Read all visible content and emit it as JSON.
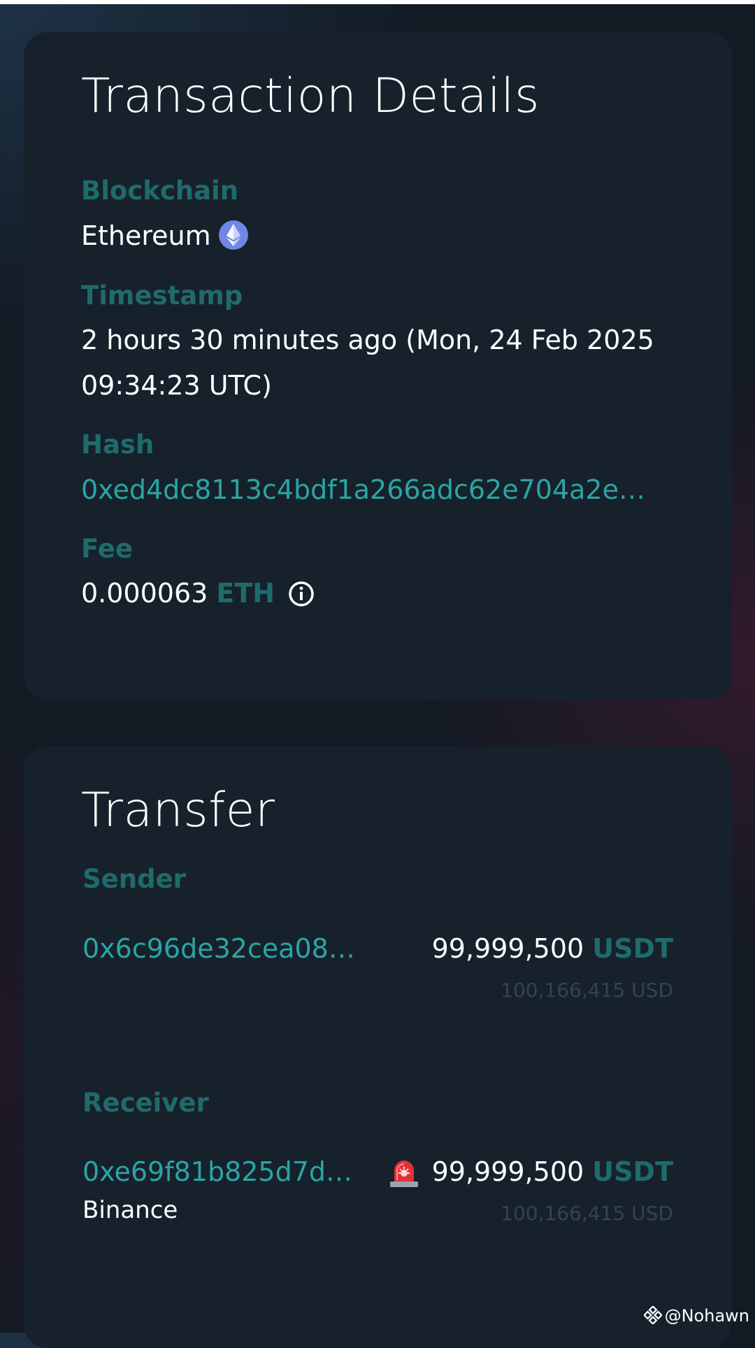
{
  "details": {
    "title": "Transaction Details",
    "blockchain_label": "Blockchain",
    "blockchain_value": "Ethereum",
    "blockchain_icon": "ethereum-icon",
    "timestamp_label": "Timestamp",
    "timestamp_value": "2 hours 30 minutes ago (Mon, 24 Feb 2025 09:34:23 UTC)",
    "hash_label": "Hash",
    "hash_value": "0xed4dc8113c4bdf1a266adc62e704a2e…",
    "fee_label": "Fee",
    "fee_amount": "0.000063",
    "fee_unit": "ETH",
    "fee_icon": "info-icon"
  },
  "transfer": {
    "title": "Transfer",
    "sender_label": "Sender",
    "sender_address": "0x6c96de32cea08…",
    "sender_amount": "99,999,500",
    "sender_unit": "USDT",
    "sender_usd": "100,166,415 USD",
    "receiver_label": "Receiver",
    "receiver_address": "0xe69f81b825d7d…",
    "receiver_entity": "Binance",
    "receiver_icon": "alarm-siren-icon",
    "receiver_amount": "99,999,500",
    "receiver_unit": "USDT",
    "receiver_usd": "100,166,415 USD"
  },
  "watermark": {
    "text": "@Nohawn",
    "icon": "binance-logo-icon"
  },
  "colors": {
    "background": "#121a23",
    "card": "#17212b",
    "label_teal": "#1f6b6b",
    "link_teal": "#2aa5a5",
    "usd_gray": "#34444f",
    "text": "#ffffff"
  }
}
